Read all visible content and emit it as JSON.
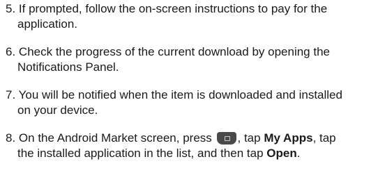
{
  "steps": [
    {
      "number": "5.",
      "line1": "If prompted, follow the on-screen instructions to pay for the",
      "line2": "application."
    },
    {
      "number": "6.",
      "line1": "Check the progress of the current download by opening the",
      "line2": "Notifications Panel."
    },
    {
      "number": "7.",
      "line1": "You will be notified when the item is downloaded and installed",
      "line2": "on your device."
    },
    {
      "number": "8.",
      "line1_a": "On the Android Market screen, press",
      "line1_b": ", tap",
      "line1_bold1": "My Apps",
      "line1_c": ", tap",
      "line2_a": "the installed application in the list, and then tap",
      "line2_bold": "Open",
      "line2_end": ".",
      "key_icon": "menu-key-icon"
    }
  ]
}
